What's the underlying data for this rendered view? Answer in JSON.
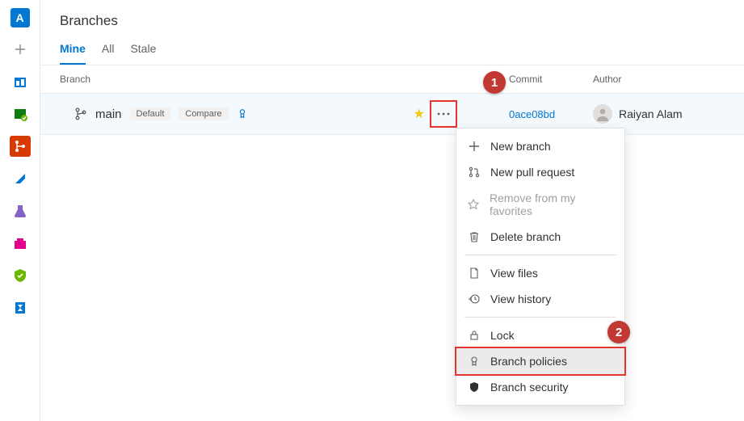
{
  "page": {
    "title": "Branches"
  },
  "sidebar": {
    "project_letter": "A"
  },
  "tabs": [
    {
      "label": "Mine",
      "active": true
    },
    {
      "label": "All",
      "active": false
    },
    {
      "label": "Stale",
      "active": false
    }
  ],
  "columns": {
    "branch": "Branch",
    "commit": "Commit",
    "author": "Author"
  },
  "branch_row": {
    "name": "main",
    "badges": [
      "Default",
      "Compare"
    ],
    "starred": true,
    "commit": "0ace08bd",
    "author": "Raiyan Alam"
  },
  "context_menu": {
    "groups": [
      [
        {
          "icon": "plus",
          "label": "New branch",
          "key": "new-branch"
        },
        {
          "icon": "pull-request",
          "label": "New pull request",
          "key": "new-pr"
        },
        {
          "icon": "star",
          "label": "Remove from my favorites",
          "key": "remove-fav",
          "disabled": true
        },
        {
          "icon": "trash",
          "label": "Delete branch",
          "key": "delete-branch"
        }
      ],
      [
        {
          "icon": "file",
          "label": "View files",
          "key": "view-files"
        },
        {
          "icon": "history",
          "label": "View history",
          "key": "view-history"
        }
      ],
      [
        {
          "icon": "lock",
          "label": "Lock",
          "key": "lock"
        },
        {
          "icon": "medal",
          "label": "Branch policies",
          "key": "branch-policies",
          "highlight": true
        },
        {
          "icon": "shield",
          "label": "Branch security",
          "key": "branch-security"
        }
      ]
    ]
  },
  "callouts": {
    "one": "1",
    "two": "2"
  }
}
